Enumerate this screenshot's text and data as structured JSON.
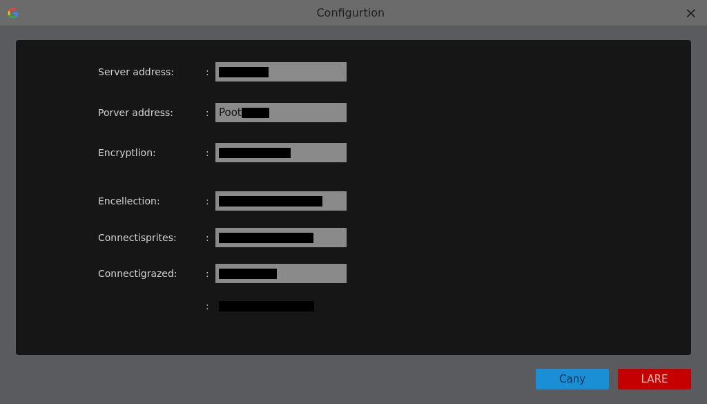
{
  "window": {
    "title": "Configurtion",
    "close": "×"
  },
  "fields": [
    {
      "label": "Server address:",
      "colon": ":",
      "boxed": true,
      "redacted": true
    },
    {
      "label": "Porver address:",
      "colon": ":",
      "boxed": true,
      "value": "Poot",
      "redacted": true
    },
    {
      "label": "Encryptlion:",
      "colon": ":",
      "boxed": true,
      "redacted": true
    },
    {
      "label": "Encellection:",
      "colon": ":",
      "boxed": true,
      "redacted": true
    },
    {
      "label": "Connectisprites:",
      "colon": ":",
      "boxed": true,
      "redacted": true
    },
    {
      "label": "Connectigrazed:",
      "colon": ":",
      "boxed": true,
      "redacted": true
    },
    {
      "colon": ":",
      "boxed": false,
      "redacted": true
    }
  ],
  "buttons": [
    {
      "label": "Cany",
      "kind": "primary"
    },
    {
      "label": "LARE",
      "kind": "danger"
    }
  ]
}
